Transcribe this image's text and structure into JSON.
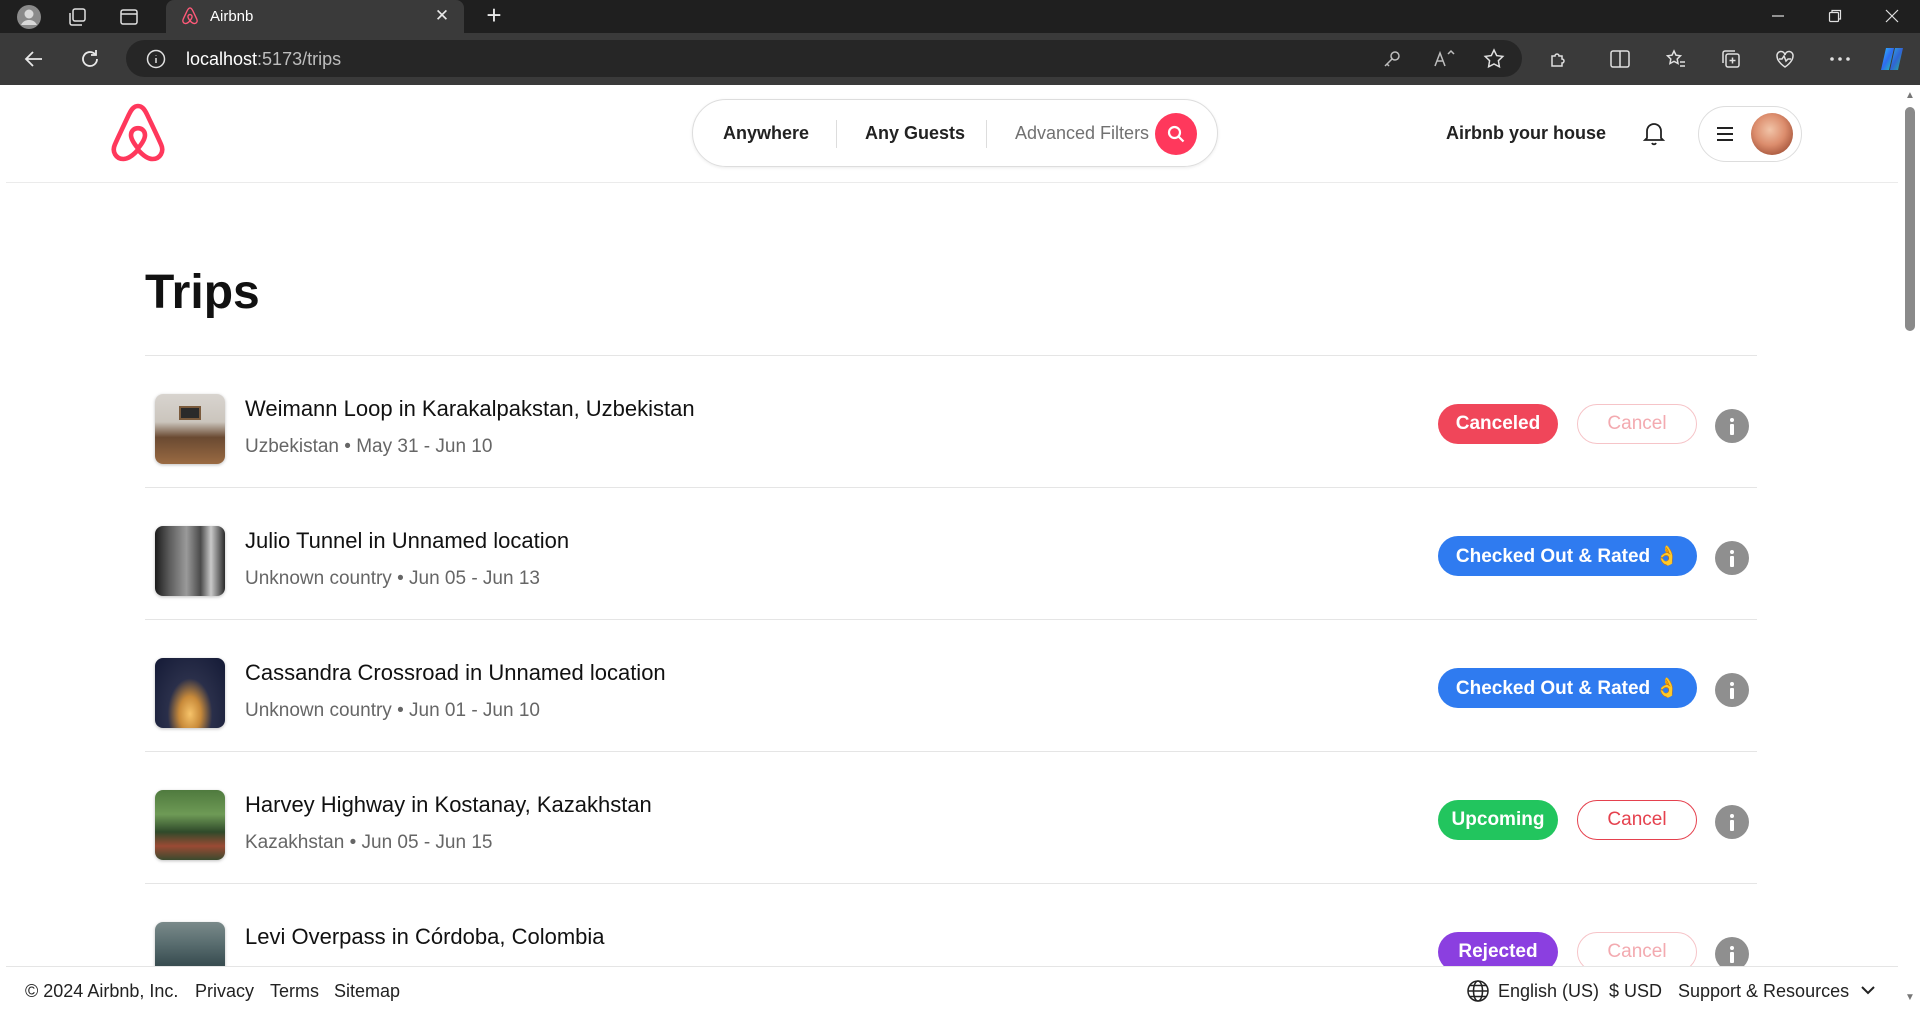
{
  "browser": {
    "tab_title": "Airbnb",
    "url_host": "localhost",
    "url_path": ":5173/trips"
  },
  "header": {
    "search": {
      "location": "Anywhere",
      "guests": "Any Guests",
      "filters": "Advanced Filters"
    },
    "host_link": "Airbnb your house"
  },
  "page": {
    "title": "Trips"
  },
  "trips": [
    {
      "title": "Weimann Loop in Karakalpakstan, Uzbekistan",
      "meta": "Uzbekistan • May 31 - Jun 10",
      "status": "Canceled",
      "action": "Cancel"
    },
    {
      "title": "Julio Tunnel in Unnamed location",
      "meta": "Unknown country • Jun 05 - Jun 13",
      "status": "Checked Out & Rated 👌"
    },
    {
      "title": "Cassandra Crossroad in Unnamed location",
      "meta": "Unknown country • Jun 01 - Jun 10",
      "status": "Checked Out & Rated 👌"
    },
    {
      "title": "Harvey Highway in Kostanay, Kazakhstan",
      "meta": "Kazakhstan • Jun 05 - Jun 15",
      "status": "Upcoming",
      "action": "Cancel"
    },
    {
      "title": "Levi Overpass in Córdoba, Colombia",
      "status": "Rejected",
      "action": "Cancel"
    }
  ],
  "footer": {
    "copyright": "© 2024 Airbnb, Inc.",
    "privacy": "Privacy",
    "terms": "Terms",
    "sitemap": "Sitemap",
    "language": "English (US)",
    "currency": "$ USD",
    "support": "Support & Resources"
  },
  "colors": {
    "brand": "#ff385c",
    "canceled": "#f0465a",
    "checked_out": "#2f7bf0",
    "upcoming": "#22c55e",
    "rejected": "#8b3fe0"
  }
}
